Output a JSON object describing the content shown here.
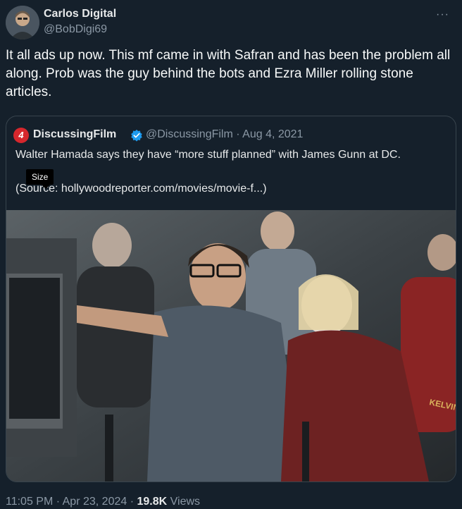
{
  "author": {
    "name": "Carlos Digital",
    "handle": "@BobDigi69",
    "avatar_icon": "profile-photo-icon"
  },
  "more_menu": "···",
  "tweet": {
    "text": "It all ads up now. This mf came in with Safran and has been the problem all along. Prob was the guy behind the bots and Ezra Miller rolling stone articles."
  },
  "quote": {
    "logo_text": "4",
    "name": "DiscussingFilm",
    "verified_icon": "verified-badge-icon",
    "handle_date": "@DiscussingFilm · Aug 4, 2021",
    "text": "Walter Hamada says they have “more stuff planned” with James Gunn at DC.",
    "source": "(Source: hollywoodreporter.com/movies/movie-f...)",
    "photo_label": "KELVIN"
  },
  "tooltip": "Size",
  "footer": {
    "time_date": "11:05 PM · Apr 23, 2024 · ",
    "views_count": "19.8K",
    "views_label": " Views"
  },
  "colors": {
    "background": "#15202b",
    "border": "#38444d",
    "muted": "#8b98a5",
    "verified": "#1d9bf0",
    "logo_red": "#d6272d"
  }
}
